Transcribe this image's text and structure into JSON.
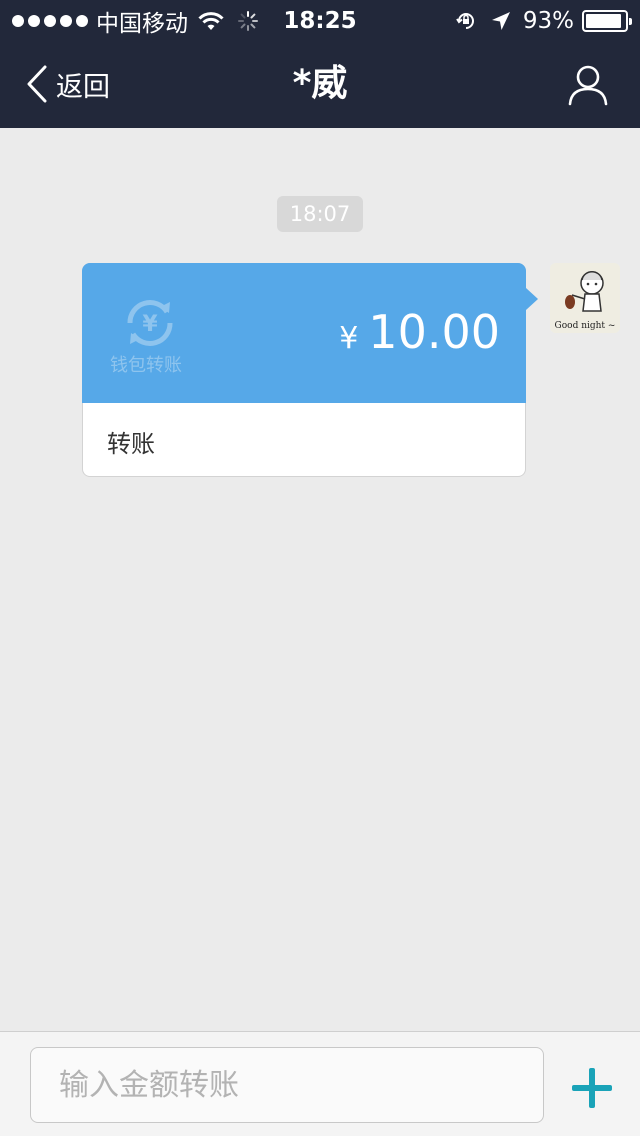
{
  "status_bar": {
    "carrier": "中国移动",
    "time": "18:25",
    "battery_percent": "93%",
    "battery_level": 0.93
  },
  "nav": {
    "back_label": "返回",
    "title": "*威"
  },
  "chat": {
    "timestamp": "18:07",
    "transfer": {
      "wallet_label": "钱包转账",
      "currency": "¥",
      "amount": "10.00",
      "label": "转账"
    },
    "avatar_caption": "Good night ~"
  },
  "input_bar": {
    "placeholder": "输入金额转账"
  },
  "colors": {
    "header_bg": "#22283a",
    "chat_bg": "#ebebeb",
    "transfer_blue": "#56a8e8",
    "plus_accent": "#1aa3b8"
  }
}
